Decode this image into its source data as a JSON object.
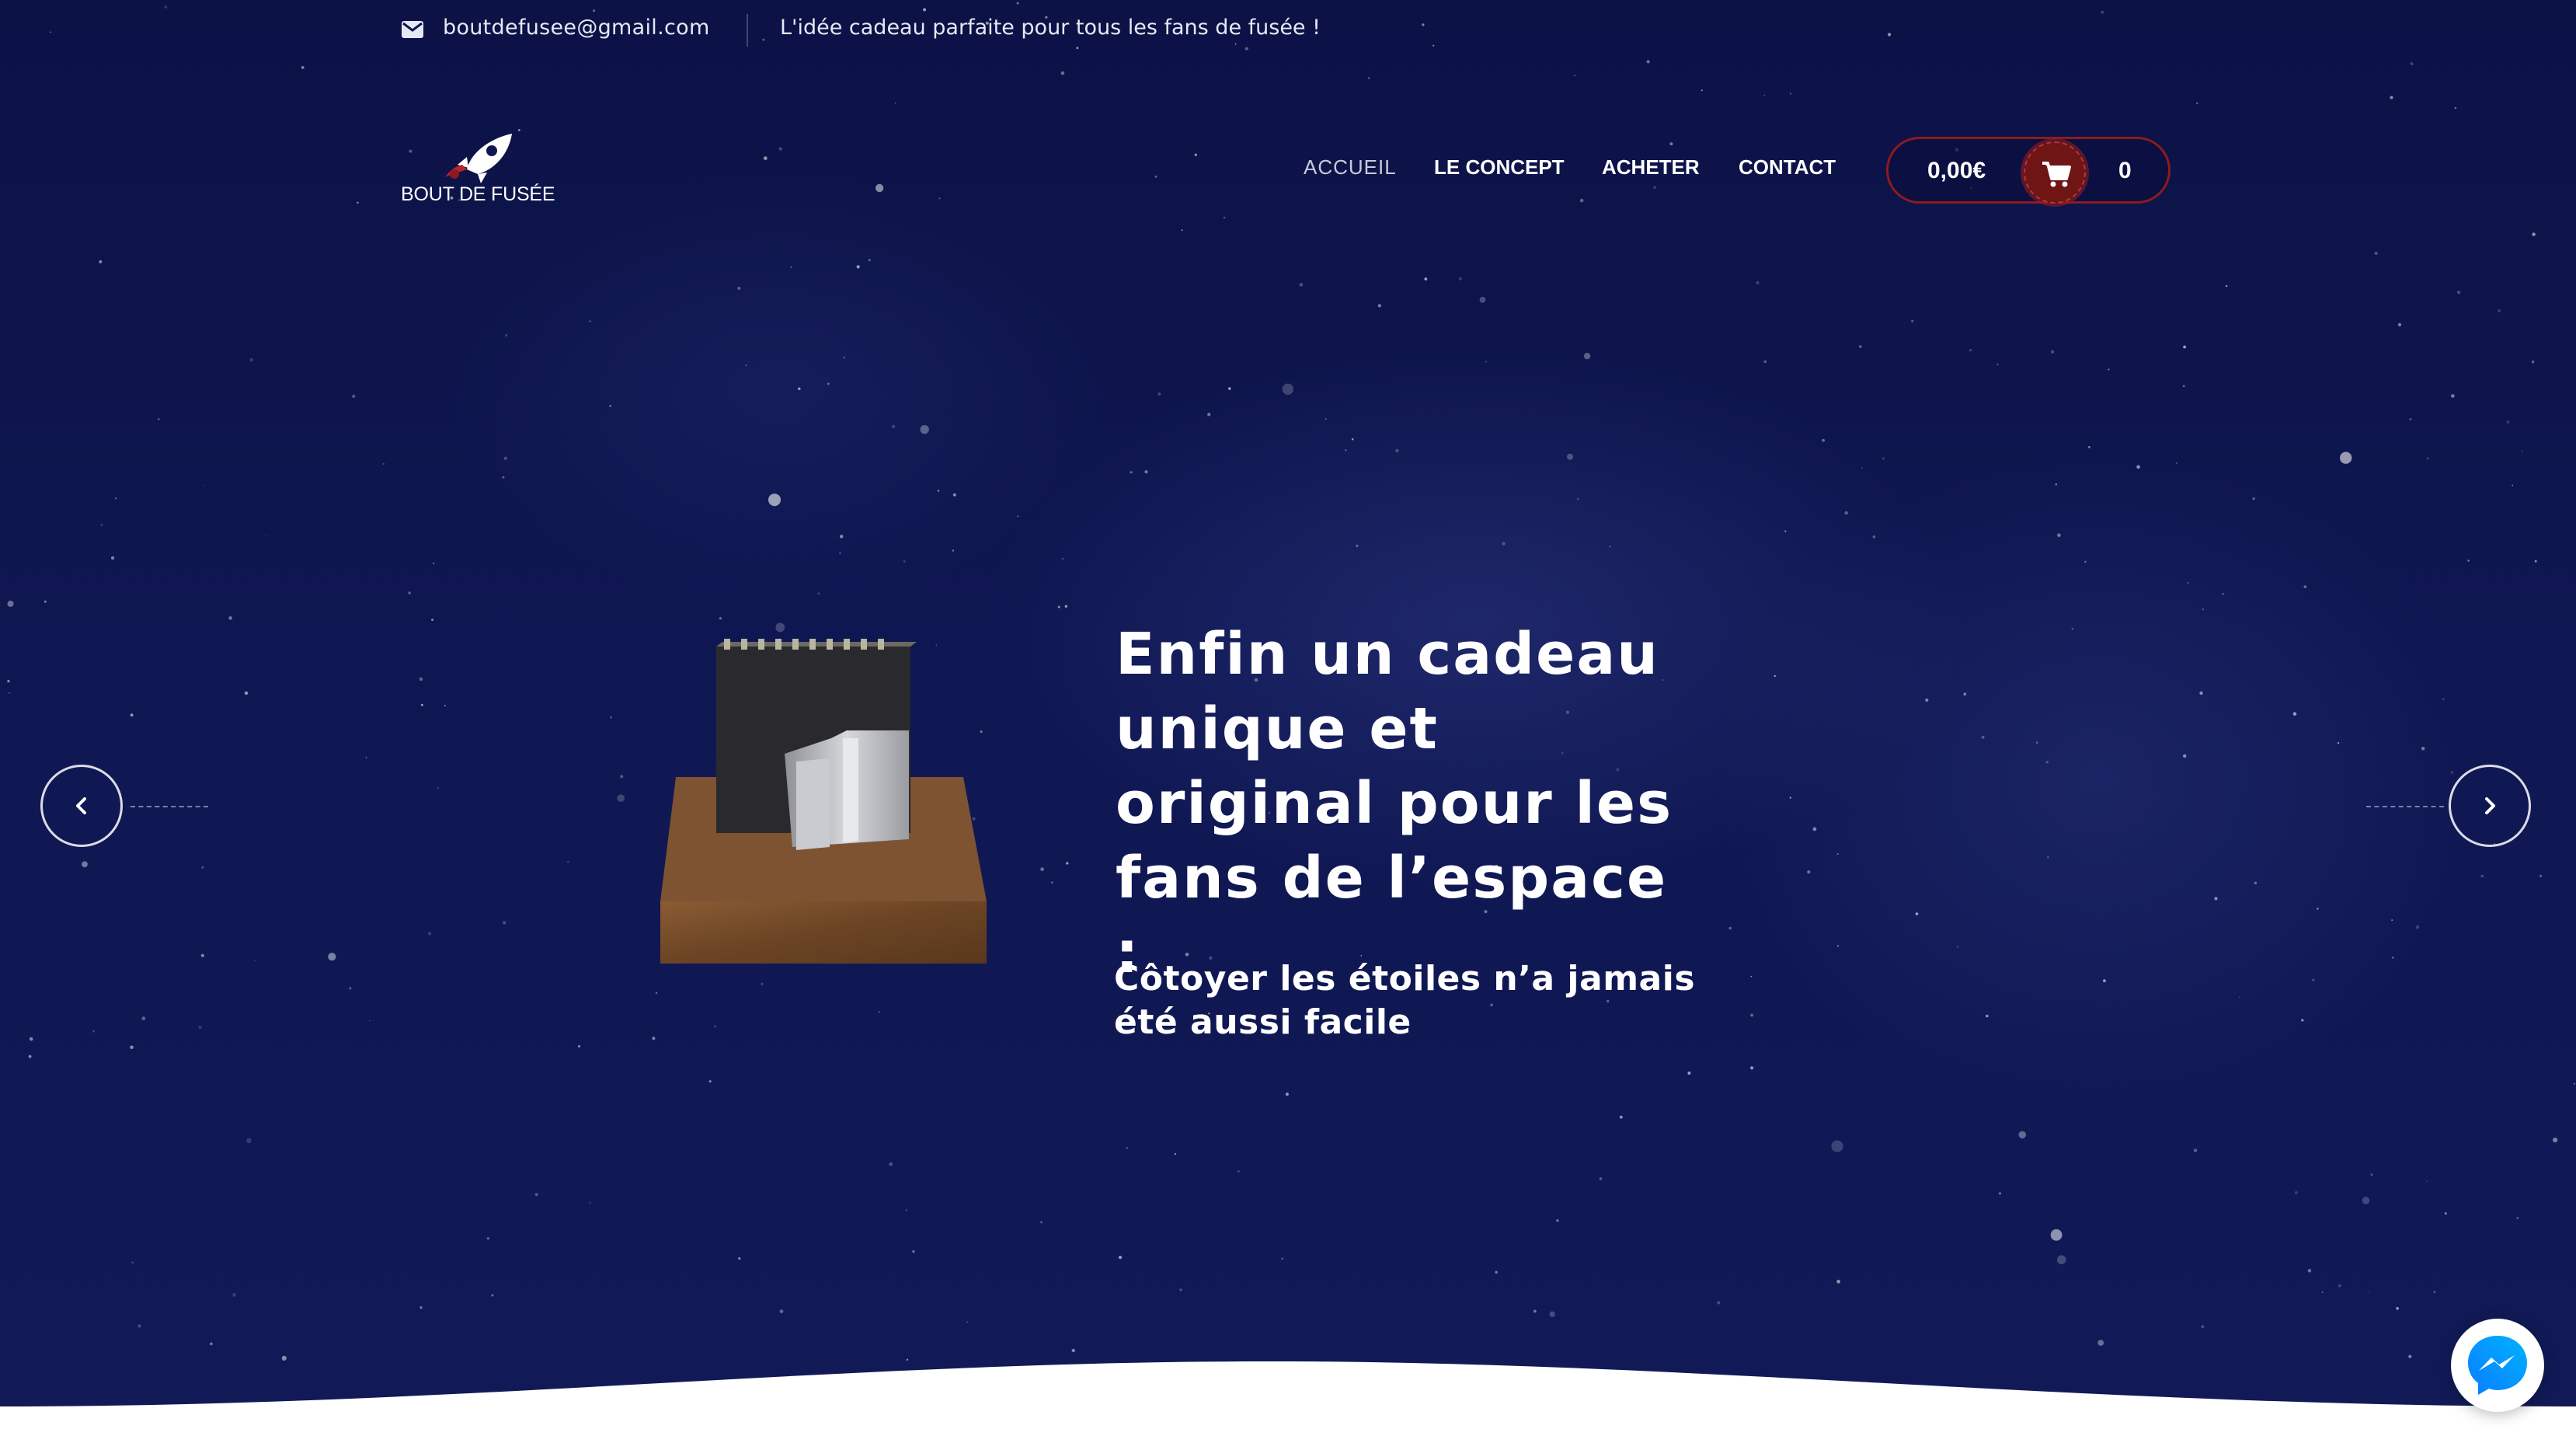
{
  "topbar": {
    "email": "boutdefusee@gmail.com",
    "tagline": "L'idée cadeau parfaite pour tous les fans de fusée !",
    "mail_icon": "envelope-icon"
  },
  "header": {
    "logo_text": "BOUT DE FUSÉE",
    "logo_icon": "rocket-icon",
    "nav": [
      {
        "label": "ACCUEIL",
        "active": true
      },
      {
        "label": "LE CONCEPT",
        "active": false
      },
      {
        "label": "ACHETER",
        "active": false
      },
      {
        "label": "CONTACT",
        "active": false
      }
    ],
    "cart": {
      "total": "0,00€",
      "count": "0",
      "icon": "cart-icon"
    }
  },
  "slider": {
    "headline": "Enfin un cadeau unique et original pour les fans de l’espace :",
    "subline": "Côtoyer les étoiles n’a jamais été aussi facile",
    "prev_icon": "chevron-left-icon",
    "next_icon": "chevron-right-icon"
  },
  "colors": {
    "background": "#0f1752",
    "cart_accent": "#8e1a1f",
    "cart_button": "#6f1515",
    "text": "#ffffff"
  },
  "chat_widget": {
    "icon": "messenger-icon"
  }
}
